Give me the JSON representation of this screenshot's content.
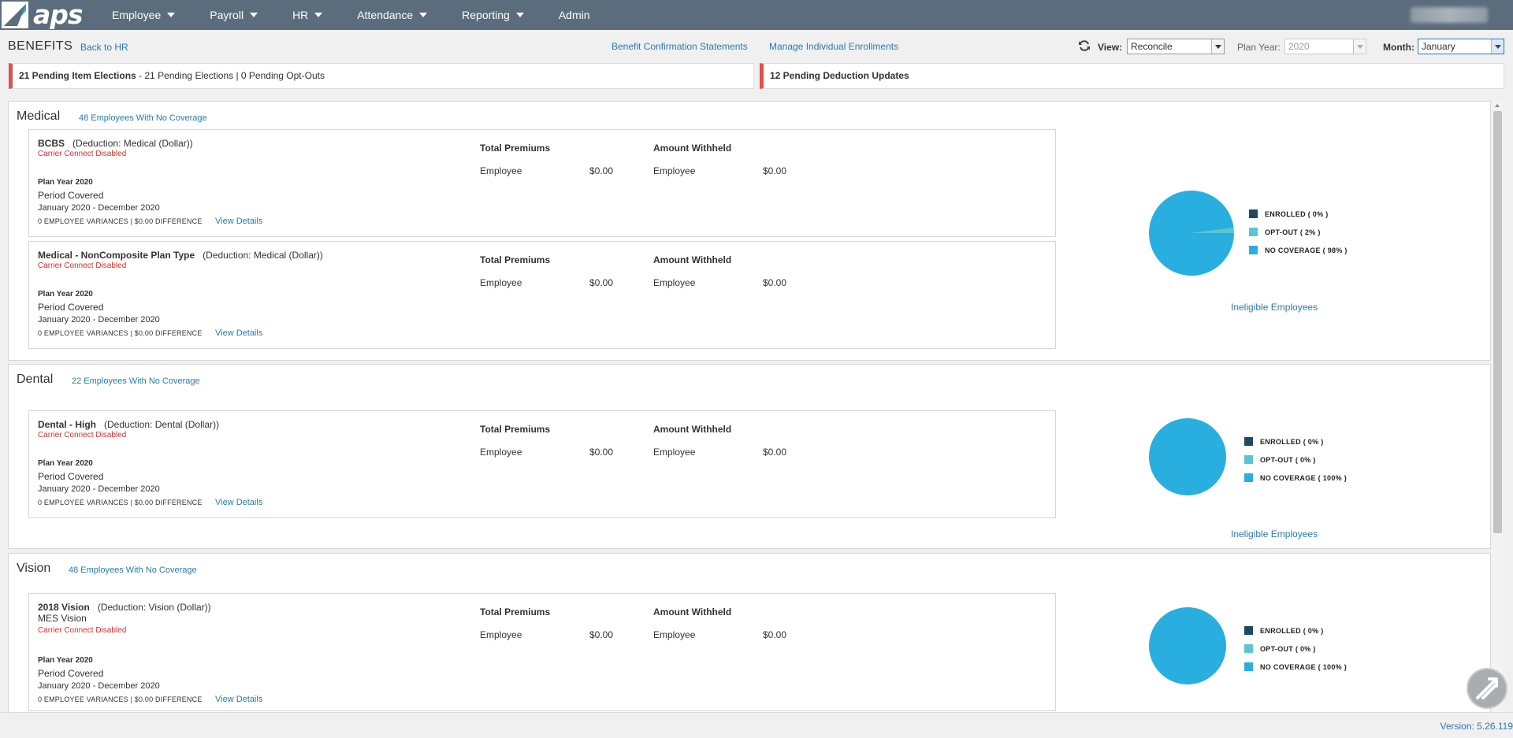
{
  "app": {
    "logo_text": "aps"
  },
  "nav": {
    "items": [
      {
        "label": "Employee",
        "has_menu": true
      },
      {
        "label": "Payroll",
        "has_menu": true
      },
      {
        "label": "HR",
        "has_menu": true
      },
      {
        "label": "Attendance",
        "has_menu": true
      },
      {
        "label": "Reporting",
        "has_menu": true
      },
      {
        "label": "Admin",
        "has_menu": false
      }
    ]
  },
  "header": {
    "title": "BENEFITS",
    "back_link": "Back to HR",
    "links": [
      "Benefit Confirmation Statements",
      "Manage Individual Enrollments"
    ],
    "view_label": "View:",
    "view_value": "Reconcile",
    "plan_year_label": "Plan Year:",
    "plan_year_value": "2020",
    "month_label": "Month:",
    "month_value": "January"
  },
  "pending": {
    "elections_bold": "21 Pending Item Elections",
    "elections_rest": " - 21 Pending Elections | 0 Pending Opt-Outs",
    "deductions": "12 Pending Deduction Updates"
  },
  "labels": {
    "total_premiums": "Total Premiums",
    "amount_withheld": "Amount Withheld",
    "employee": "Employee",
    "period_covered": "Period Covered",
    "view_details": "View Details",
    "ineligible": "Ineligible Employees",
    "legend_enrolled": "ENROLLED",
    "legend_optout": "OPT-OUT",
    "legend_nocov": "NO COVERAGE"
  },
  "colors": {
    "enrolled": "#1d4a5e",
    "optout": "#5cc6d0",
    "nocoverage": "#29aee0",
    "accent": "#2a7ab0",
    "nav_bg": "#5b6d7c"
  },
  "sections": [
    {
      "title": "Medical",
      "no_coverage": "48 Employees With No Coverage",
      "pie": {
        "enrolled": 0,
        "optout": 2,
        "nocoverage": 98,
        "legend": [
          "ENROLLED ( 0% )",
          "OPT-OUT ( 2% )",
          "NO COVERAGE ( 98% )"
        ]
      },
      "plans": [
        {
          "name": "BCBS",
          "deduction": "(Deduction: Medical (Dollar))",
          "sub": "",
          "carrier": "Carrier Connect Disabled",
          "plan_year": "Plan Year 2020",
          "range": "January 2020 - December 2020",
          "variances": "0 EMPLOYEE VARIANCES | $0.00 DIFFERENCE",
          "premium": "$0.00",
          "withheld": "$0.00"
        },
        {
          "name": "Medical - NonComposite Plan Type",
          "deduction": "(Deduction: Medical (Dollar))",
          "sub": "",
          "carrier": "Carrier Connect Disabled",
          "plan_year": "Plan Year 2020",
          "range": "January 2020 - December 2020",
          "variances": "0 EMPLOYEE VARIANCES | $0.00 DIFFERENCE",
          "premium": "$0.00",
          "withheld": "$0.00"
        }
      ]
    },
    {
      "title": "Dental",
      "no_coverage": "22 Employees With No Coverage",
      "pie": {
        "enrolled": 0,
        "optout": 0,
        "nocoverage": 100,
        "legend": [
          "ENROLLED ( 0% )",
          "OPT-OUT ( 0% )",
          "NO COVERAGE ( 100% )"
        ]
      },
      "plans": [
        {
          "name": "Dental - High",
          "deduction": "(Deduction: Dental (Dollar))",
          "sub": "",
          "carrier": "Carrier Connect Disabled",
          "plan_year": "Plan Year 2020",
          "range": "January 2020 - December 2020",
          "variances": "0 EMPLOYEE VARIANCES | $0.00 DIFFERENCE",
          "premium": "$0.00",
          "withheld": "$0.00"
        }
      ]
    },
    {
      "title": "Vision",
      "no_coverage": "48 Employees With No Coverage",
      "pie": {
        "enrolled": 0,
        "optout": 0,
        "nocoverage": 100,
        "legend": [
          "ENROLLED ( 0% )",
          "OPT-OUT ( 0% )",
          "NO COVERAGE ( 100% )"
        ]
      },
      "plans": [
        {
          "name": "2018 Vision",
          "deduction": "(Deduction: Vision (Dollar))",
          "sub": "MES Vision",
          "carrier": "Carrier Connect Disabled",
          "plan_year": "Plan Year 2020",
          "range": "January 2020 - December 2020",
          "variances": "0 EMPLOYEE VARIANCES | $0.00 DIFFERENCE",
          "premium": "$0.00",
          "withheld": "$0.00"
        }
      ]
    }
  ],
  "footer": {
    "version": "Version: 5.26.119"
  }
}
